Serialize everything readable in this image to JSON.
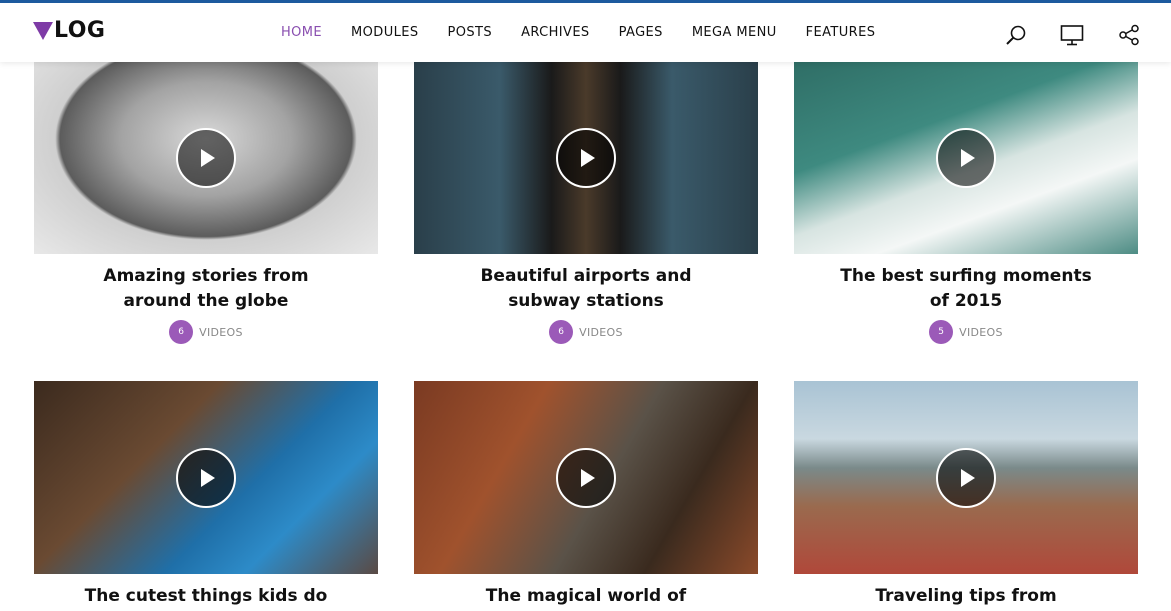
{
  "brand": {
    "logo_text": "LOG"
  },
  "nav": {
    "items": [
      {
        "label": "HOME",
        "active": true
      },
      {
        "label": "MODULES"
      },
      {
        "label": "POSTS"
      },
      {
        "label": "ARCHIVES"
      },
      {
        "label": "PAGES"
      },
      {
        "label": "MEGA MENU"
      },
      {
        "label": "FEATURES"
      }
    ]
  },
  "toolbar": {
    "icons": [
      "search-icon",
      "monitor-icon",
      "share-icon"
    ]
  },
  "colors": {
    "accent": "#8a4fb0",
    "badge": "#9b5ab8",
    "topline": "#1c5a9e"
  },
  "cards": [
    {
      "title": "Amazing stories from around the globe",
      "count": "6",
      "label": "VIDEOS"
    },
    {
      "title": "Beautiful airports and subway stations",
      "count": "6",
      "label": "VIDEOS"
    },
    {
      "title": "The best surfing moments of 2015",
      "count": "5",
      "label": "VIDEOS"
    },
    {
      "title": "The cutest things kids do",
      "count": "",
      "label": ""
    },
    {
      "title": "The magical world of",
      "count": "",
      "label": ""
    },
    {
      "title": "Traveling tips from",
      "count": "",
      "label": ""
    }
  ]
}
